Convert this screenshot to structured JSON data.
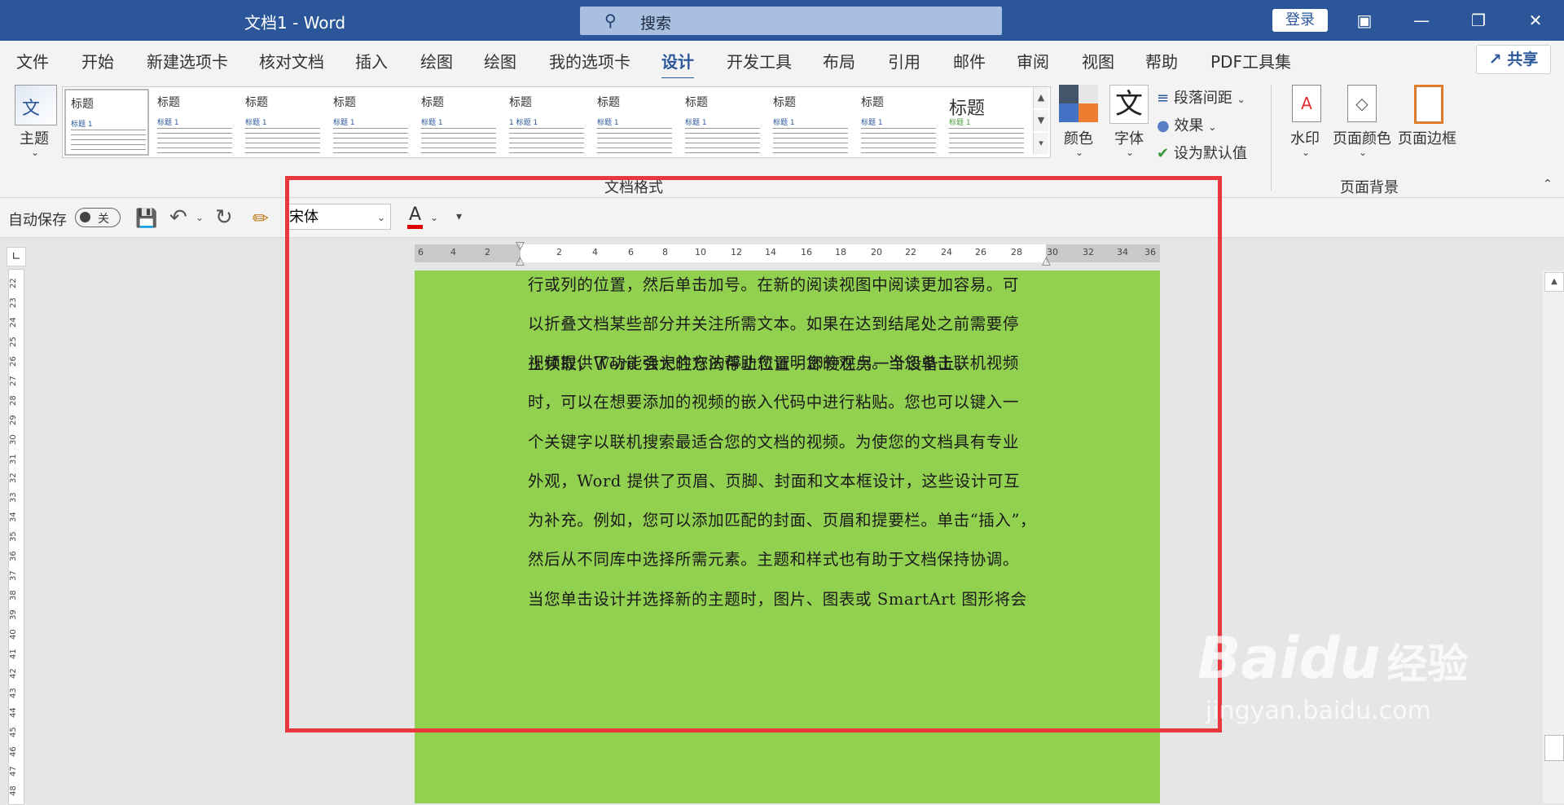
{
  "window": {
    "title": "文档1  -  Word",
    "login": "登录"
  },
  "search": {
    "placeholder": "搜索"
  },
  "tabs": [
    "文件",
    "开始",
    "新建选项卡",
    "核对文档",
    "插入",
    "绘图",
    "绘图",
    "我的选项卡",
    "设计",
    "开发工具",
    "布局",
    "引用",
    "邮件",
    "审阅",
    "视图",
    "帮助",
    "PDF工具集"
  ],
  "active_tab": "设计",
  "share": "共享",
  "ribbon": {
    "theme_label": "主题",
    "gallery_thumbs": [
      {
        "heading": "标题",
        "sub": "标题 1"
      },
      {
        "heading": "标题",
        "sub": "标题 1"
      },
      {
        "heading": "标题",
        "sub": "标题 1"
      },
      {
        "heading": "标题",
        "sub": "标题 1"
      },
      {
        "heading": "标题",
        "sub": "标题 1"
      },
      {
        "heading": "标题",
        "sub": "1  标题 1"
      },
      {
        "heading": "标题",
        "sub": "标题 1"
      },
      {
        "heading": "标题",
        "sub": "标题 1"
      },
      {
        "heading": "标题",
        "sub": "标题 1"
      },
      {
        "heading": "标题",
        "sub": "标题 1"
      },
      {
        "heading": "标题",
        "sub": "标题 1"
      }
    ],
    "doc_format_label": "文档格式",
    "colors_label": "颜色",
    "fonts_label": "字体",
    "fonts_glyph": "文",
    "paragraph_spacing": "段落间距",
    "effects": "效果",
    "set_default": "设为默认值",
    "watermark": "水印",
    "page_color": "页面颜色",
    "page_borders": "页面边框",
    "page_background_label": "页面背景"
  },
  "qat": {
    "autosave": "自动保存",
    "toggle": "关",
    "font": "宋体",
    "font_color_glyph": "A"
  },
  "ruler": {
    "numbers": [
      "6",
      "4",
      "2",
      "2",
      "4",
      "6",
      "8",
      "10",
      "12",
      "14",
      "16",
      "18",
      "20",
      "22",
      "24",
      "26",
      "28",
      "30",
      "32",
      "34",
      "36"
    ]
  },
  "vruler": {
    "numbers": [
      "22",
      "23",
      "24",
      "25",
      "26",
      "27",
      "28",
      "29",
      "30",
      "31",
      "32",
      "33",
      "34",
      "35",
      "36",
      "37",
      "38",
      "39",
      "40",
      "41",
      "42",
      "43",
      "44",
      "45",
      "46",
      "47",
      "48"
    ]
  },
  "document": {
    "paragraph1": [
      "行或列的位置，然后单击加号。在新的阅读视图中阅读更加容易。可",
      "以折叠文档某些部分并关注所需文本。如果在达到结尾处之前需要停",
      "止读取，Word 会记住您的停止位置 - 即使在另一个设备上。"
    ],
    "paragraph2": [
      "视频提供了功能强大的方法帮助您证明您的观点。当您单击联机视频",
      "时，可以在想要添加的视频的嵌入代码中进行粘贴。您也可以键入一",
      "个关键字以联机搜索最适合您的文档的视频。为使您的文档具有专业",
      "外观，Word 提供了页眉、页脚、封面和文本框设计，这些设计可互",
      "为补充。例如，您可以添加匹配的封面、页眉和提要栏。单击“插入”，",
      "然后从不同库中选择所需元素。主题和样式也有助于文档保持协调。",
      "当您单击设计并选择新的主题时，图片、图表或 SmartArt 图形将会"
    ]
  },
  "watermark": {
    "brand": "Baidu",
    "cn": "经验",
    "url": "jingyan.baidu.com"
  },
  "colors": {
    "title_bar": "#2b579a",
    "page": "#92d050",
    "highlight_box": "#e8383d"
  }
}
